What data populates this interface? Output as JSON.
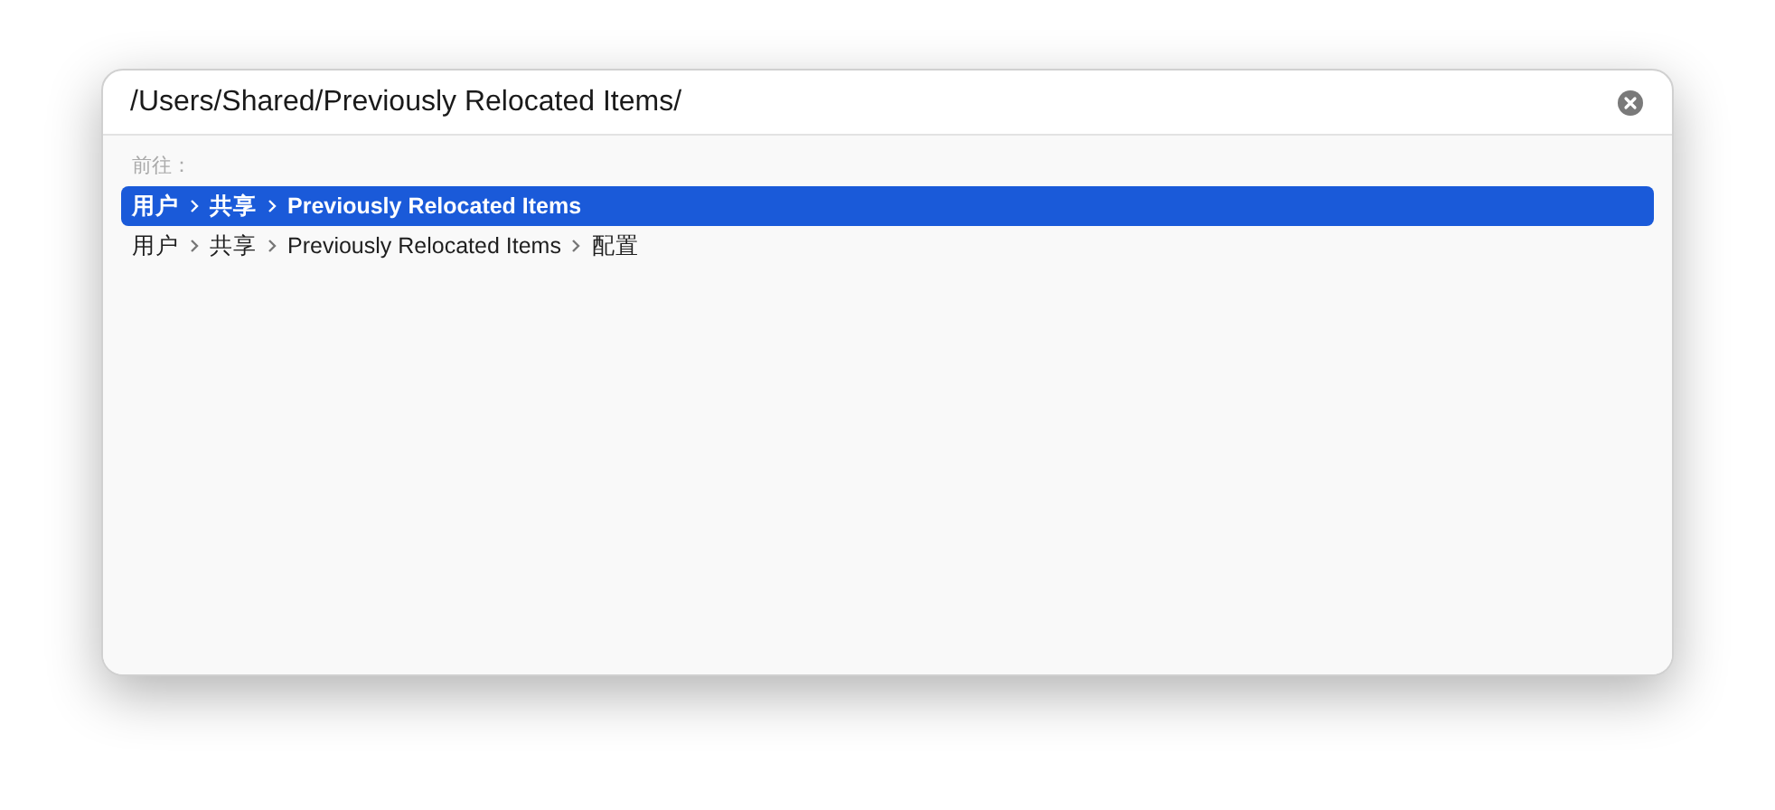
{
  "path_field": {
    "value": "/Users/Shared/Previously Relocated Items/"
  },
  "go_to_label": "前往：",
  "suggestions": [
    {
      "segments": [
        "用户",
        "共享",
        "Previously Relocated Items"
      ],
      "selected": true
    },
    {
      "segments": [
        "用户",
        "共享",
        "Previously Relocated Items",
        "配置"
      ],
      "selected": false
    }
  ]
}
